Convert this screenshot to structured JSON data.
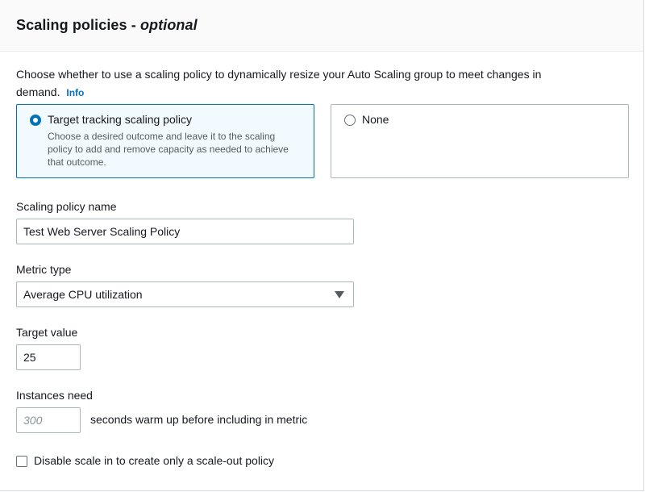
{
  "header": {
    "title": "Scaling policies - ",
    "title_suffix": "optional"
  },
  "description": {
    "text": "Choose whether to use a scaling policy to dynamically resize your Auto Scaling group to meet changes in demand.",
    "info_link": "Info"
  },
  "options": [
    {
      "label": "Target tracking scaling policy",
      "description": "Choose a desired outcome and leave it to the scaling policy to add and remove capacity as needed to achieve that outcome.",
      "selected": true
    },
    {
      "label": "None",
      "selected": false
    }
  ],
  "policy_name": {
    "label": "Scaling policy name",
    "value": "Test Web Server Scaling Policy"
  },
  "metric_type": {
    "label": "Metric type",
    "selected": "Average CPU utilization"
  },
  "target_value": {
    "label": "Target value",
    "value": "25"
  },
  "warmup": {
    "label": "Instances need",
    "placeholder": "300",
    "value": "",
    "suffix": "seconds warm up before including in metric"
  },
  "disable_scale_in": {
    "label": "Disable scale in to create only a scale-out policy",
    "checked": false
  },
  "colors": {
    "accent": "#0073bb",
    "selected_tile_bg": "#f1faff",
    "border": "#aab7b8",
    "text": "#16191f",
    "secondary_text": "#545b64"
  }
}
